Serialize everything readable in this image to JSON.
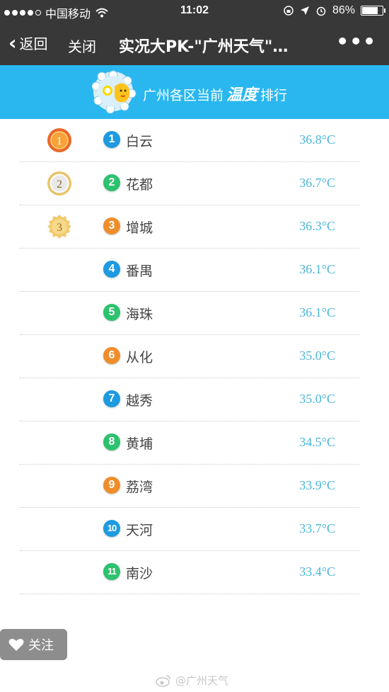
{
  "status_bar": {
    "carrier": "中国移动",
    "time": "11:02",
    "battery": "86%",
    "battery_level": 0.86
  },
  "nav": {
    "back_label": "返回",
    "close_label": "关闭",
    "title": "实况大PK-\"广州天气\"…",
    "more_label": "•••"
  },
  "banner": {
    "prefix": "广州各区当前",
    "highlight": "温度",
    "suffix": "排行"
  },
  "ranking": [
    {
      "rank": "1",
      "district": "白云",
      "temp": "36.8°C",
      "medal": "1",
      "color": "#1e9ae0"
    },
    {
      "rank": "2",
      "district": "花都",
      "temp": "36.7°C",
      "medal": "2",
      "color": "#2cc26e"
    },
    {
      "rank": "3",
      "district": "增城",
      "temp": "36.3°C",
      "medal": "3",
      "color": "#ef8d2a"
    },
    {
      "rank": "4",
      "district": "番禺",
      "temp": "36.1°C",
      "color": "#1e9ae0"
    },
    {
      "rank": "5",
      "district": "海珠",
      "temp": "36.1°C",
      "color": "#2cc26e"
    },
    {
      "rank": "6",
      "district": "从化",
      "temp": "35.0°C",
      "color": "#ef8d2a"
    },
    {
      "rank": "7",
      "district": "越秀",
      "temp": "35.0°C",
      "color": "#1e9ae0"
    },
    {
      "rank": "8",
      "district": "黄埔",
      "temp": "34.5°C",
      "color": "#2cc26e"
    },
    {
      "rank": "9",
      "district": "荔湾",
      "temp": "33.9°C",
      "color": "#ef8d2a"
    },
    {
      "rank": "10",
      "district": "天河",
      "temp": "33.7°C",
      "color": "#1e9ae0"
    },
    {
      "rank": "11",
      "district": "南沙",
      "temp": "33.4°C",
      "color": "#2cc26e"
    }
  ],
  "follow": {
    "label": "关注"
  },
  "watermark": {
    "text": "@广州天气"
  },
  "colors": {
    "banner": "#2ab7f0",
    "temp_text": "#4bb6d8",
    "dark_bar": "#383838"
  }
}
